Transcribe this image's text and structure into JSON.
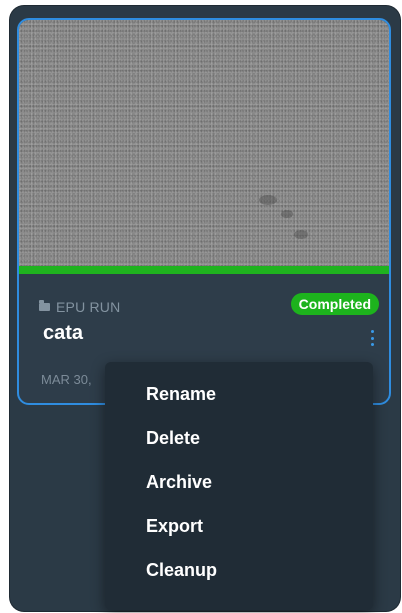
{
  "card": {
    "type_label": "EPU RUN",
    "status_badge": "Completed",
    "name": "cata",
    "date": "MAR 30,",
    "progress_percent": 100
  },
  "menu": {
    "items": [
      "Rename",
      "Delete",
      "Archive",
      "Export",
      "Cleanup"
    ]
  },
  "colors": {
    "card_border": "#2f8de0",
    "progress_fill": "#1fb31f",
    "badge_bg": "#1db31d",
    "panel_bg": "#2b3a46",
    "menu_bg": "#202c36"
  },
  "icons": {
    "type_icon": "folder-icon",
    "menu_trigger": "kebab-menu-icon"
  }
}
